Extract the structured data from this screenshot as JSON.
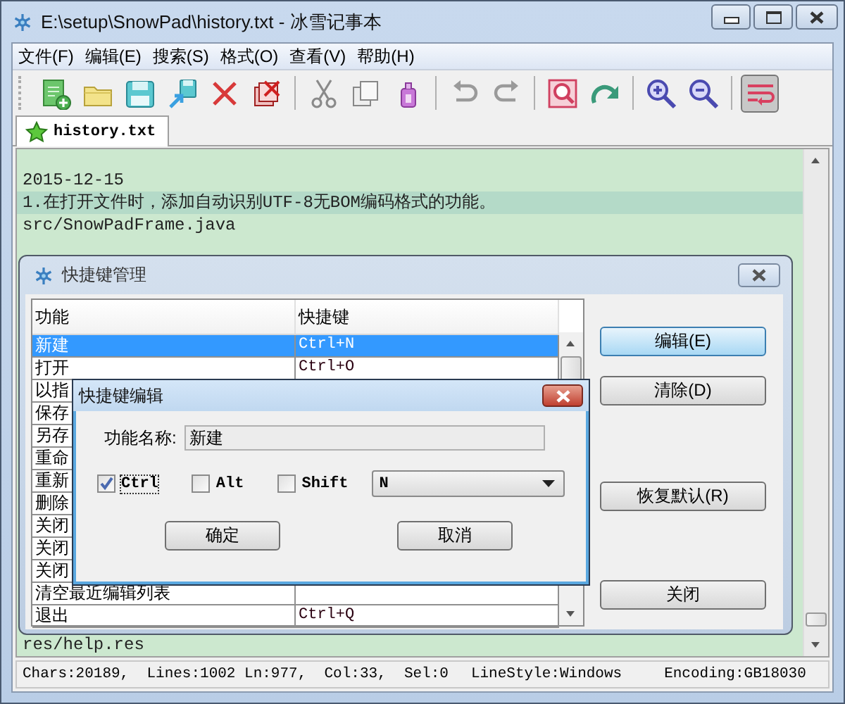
{
  "window": {
    "title": "E:\\setup\\SnowPad\\history.txt - 冰雪记事本"
  },
  "menu": [
    "文件(F)",
    "编辑(E)",
    "搜索(S)",
    "格式(O)",
    "查看(V)",
    "帮助(H)"
  ],
  "toolbar": [
    {
      "kind": "new",
      "on": false
    },
    {
      "kind": "open",
      "on": false
    },
    {
      "kind": "save",
      "on": false
    },
    {
      "kind": "save-as",
      "on": false
    },
    {
      "kind": "close",
      "on": false
    },
    {
      "kind": "close-all",
      "on": false
    },
    {
      "kind": "separator"
    },
    {
      "kind": "cut",
      "on": false
    },
    {
      "kind": "copy",
      "on": false
    },
    {
      "kind": "paste",
      "on": false
    },
    {
      "kind": "separator"
    },
    {
      "kind": "undo",
      "on": false
    },
    {
      "kind": "redo",
      "on": false
    },
    {
      "kind": "separator"
    },
    {
      "kind": "find",
      "on": false
    },
    {
      "kind": "replace",
      "on": false
    },
    {
      "kind": "separator"
    },
    {
      "kind": "zoom-in",
      "on": false
    },
    {
      "kind": "zoom-out",
      "on": false
    },
    {
      "kind": "separator"
    },
    {
      "kind": "wrap",
      "on": true
    }
  ],
  "tabs": [
    {
      "label": "history.txt",
      "selected": true
    }
  ],
  "editor": {
    "lines": [
      {
        "text": "2015-12-15",
        "current": false
      },
      {
        "text": "1.在打开文件时，添加自动识别UTF-8无BOM编码格式的功能。",
        "current": true
      },
      {
        "text": "src/SnowPadFrame.java",
        "current": false
      }
    ],
    "last_line": "res/help.res"
  },
  "status_bar": [
    "Chars:20189,  Lines:1002 Ln:977,  Col:33,  Sel:0",
    "LineStyle:Windows",
    "Encoding:GB18030"
  ],
  "shortcut_dialog": {
    "title": "快捷键管理",
    "columns": [
      "功能",
      "快捷键"
    ],
    "rows": [
      {
        "function": "新建",
        "shortcut": "Ctrl+N",
        "selected": true
      },
      {
        "function": "打开",
        "shortcut": "Ctrl+O",
        "selected": false
      },
      {
        "function": "以指",
        "selected": false
      },
      {
        "function": "保存",
        "selected": false
      },
      {
        "function": "另存",
        "selected": false
      },
      {
        "function": "重命",
        "selected": false
      },
      {
        "function": "重新",
        "selected": false
      },
      {
        "function": "删除",
        "selected": false
      },
      {
        "function": "关闭",
        "selected": false
      },
      {
        "function": "关闭",
        "selected": false
      },
      {
        "function": "关闭",
        "selected": false
      },
      {
        "function": "清空最近编辑列表",
        "selected": false
      },
      {
        "function": "退出",
        "shortcut": "Ctrl+Q",
        "selected": false
      }
    ],
    "buttons": [
      {
        "label": "编辑(E)",
        "default": true
      },
      {
        "label": "清除(D)",
        "default": false
      },
      {
        "label": "恢复默认(R)",
        "default": false
      },
      {
        "label": "关闭",
        "default": false
      }
    ]
  },
  "edit_dialog": {
    "title": "快捷键编辑",
    "name_label": "功能名称:",
    "name_value": "新建",
    "modifiers": [
      {
        "label": "Ctrl",
        "checked": true
      },
      {
        "label": "Alt",
        "checked": false
      },
      {
        "label": "Shift",
        "checked": false
      }
    ],
    "key": "N",
    "buttons": [
      "确定",
      "取消"
    ]
  }
}
